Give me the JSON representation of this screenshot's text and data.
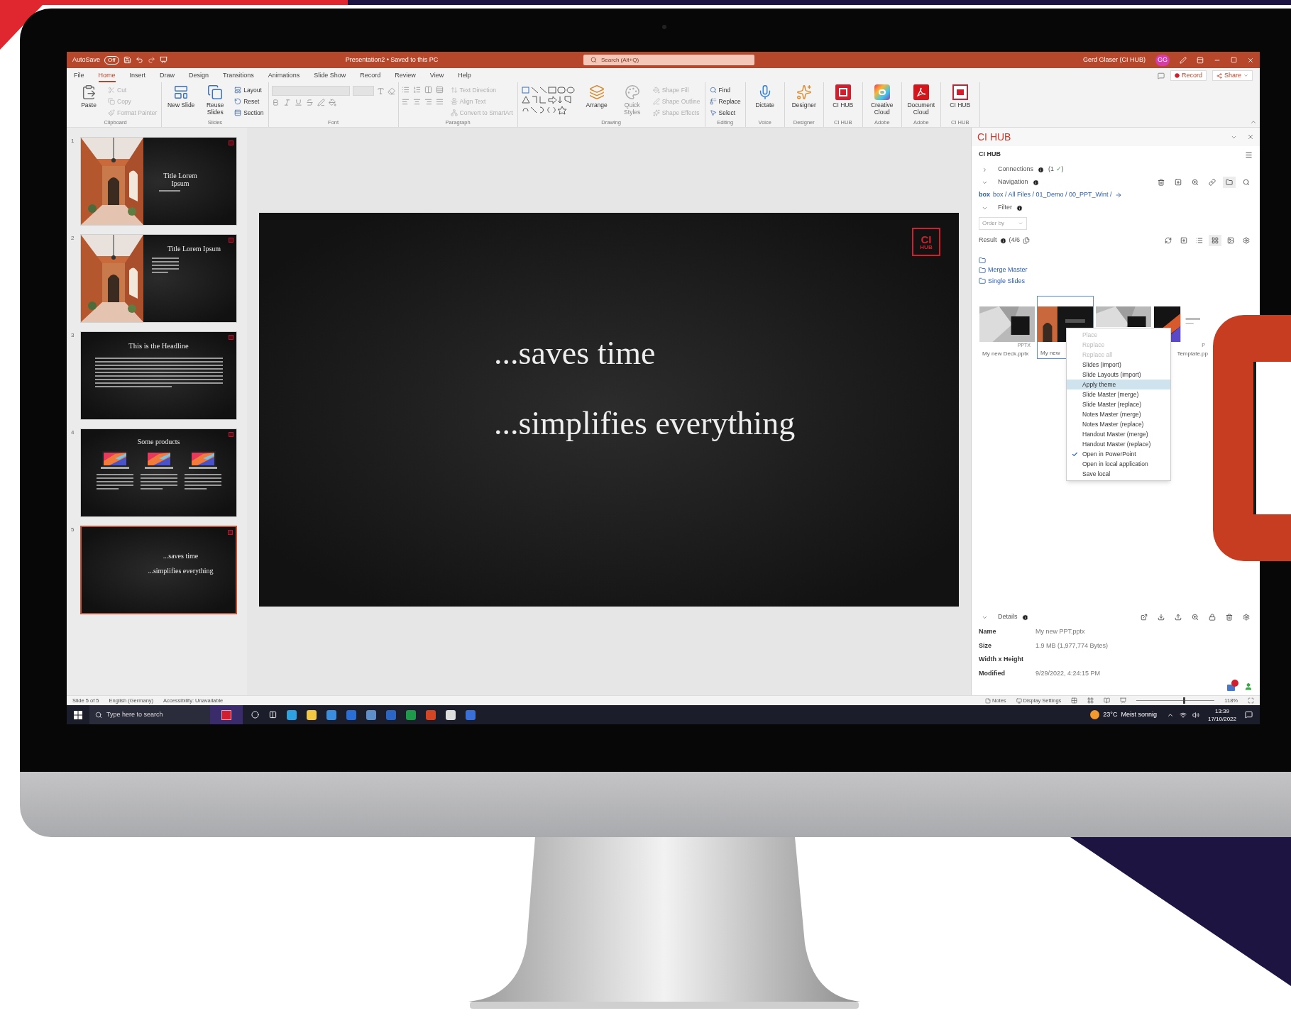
{
  "title_bar": {
    "autosave_label": "AutoSave",
    "autosave_state": "Off",
    "autosave_on": false,
    "document_title": "Presentation2 • Saved to this PC",
    "search_placeholder": "Search (Alt+Q)",
    "user_name": "Gerd Glaser (CI HUB)",
    "user_initials": "GG"
  },
  "ribbon_tabs": [
    {
      "label": "File",
      "selected": false
    },
    {
      "label": "Home",
      "selected": true
    },
    {
      "label": "Insert",
      "selected": false
    },
    {
      "label": "Draw",
      "selected": false
    },
    {
      "label": "Design",
      "selected": false
    },
    {
      "label": "Transitions",
      "selected": false
    },
    {
      "label": "Animations",
      "selected": false
    },
    {
      "label": "Slide Show",
      "selected": false
    },
    {
      "label": "Record",
      "selected": false
    },
    {
      "label": "Review",
      "selected": false
    },
    {
      "label": "View",
      "selected": false
    },
    {
      "label": "Help",
      "selected": false
    }
  ],
  "ribbon_actions": {
    "record": "Record",
    "share": "Share"
  },
  "ribbon_groups": [
    {
      "label": "Clipboard",
      "kind": "commands",
      "commands": [
        {
          "label": "Paste",
          "kind": "large",
          "disabled": false
        },
        {
          "label": "Cut",
          "kind": "small",
          "disabled": true
        },
        {
          "label": "Copy",
          "kind": "small",
          "disabled": true
        },
        {
          "label": "Format Painter",
          "kind": "small",
          "disabled": true
        }
      ]
    },
    {
      "label": "Slides",
      "kind": "commands",
      "commands": [
        {
          "label": "New Slide",
          "kind": "large",
          "disabled": false
        },
        {
          "label": "Reuse Slides",
          "kind": "large",
          "disabled": false
        },
        {
          "label": "Layout",
          "kind": "small",
          "disabled": false
        },
        {
          "label": "Reset",
          "kind": "small",
          "disabled": false
        },
        {
          "label": "Section",
          "kind": "small",
          "disabled": false
        }
      ]
    },
    {
      "label": "Font",
      "kind": "font"
    },
    {
      "label": "Paragraph",
      "kind": "paragraph",
      "commands": [
        {
          "label": "Text Direction",
          "kind": "small",
          "disabled": true
        },
        {
          "label": "Align Text",
          "kind": "small",
          "disabled": true
        },
        {
          "label": "Convert to SmartArt",
          "kind": "small",
          "disabled": true
        }
      ]
    },
    {
      "label": "Drawing",
      "kind": "drawing",
      "commands": [
        {
          "label": "Arrange",
          "kind": "large",
          "disabled": false
        },
        {
          "label": "Quick Styles",
          "kind": "large",
          "disabled": true
        },
        {
          "label": "Shape Fill",
          "kind": "small",
          "disabled": true
        },
        {
          "label": "Shape Outline",
          "kind": "small",
          "disabled": true
        },
        {
          "label": "Shape Effects",
          "kind": "small",
          "disabled": true
        }
      ]
    },
    {
      "label": "Editing",
      "kind": "commands",
      "commands": [
        {
          "label": "Find",
          "kind": "small",
          "disabled": false
        },
        {
          "label": "Replace",
          "kind": "small",
          "disabled": false
        },
        {
          "label": "Select",
          "kind": "small",
          "disabled": false
        }
      ]
    },
    {
      "label": "Voice",
      "kind": "commands",
      "commands": [
        {
          "label": "Dictate",
          "kind": "large",
          "disabled": false
        }
      ]
    },
    {
      "label": "Designer",
      "kind": "commands",
      "commands": [
        {
          "label": "Designer",
          "kind": "large",
          "disabled": false
        }
      ]
    },
    {
      "label": "CI HUB",
      "kind": "commands",
      "commands": [
        {
          "label": "CI HUB",
          "kind": "large",
          "disabled": false
        }
      ]
    },
    {
      "label": "Adobe",
      "kind": "commands",
      "commands": [
        {
          "label": "Creative Cloud",
          "kind": "large",
          "disabled": false
        }
      ]
    },
    {
      "label": "Adobe",
      "kind": "commands",
      "commands": [
        {
          "label": "Document Cloud",
          "kind": "large",
          "disabled": false
        }
      ]
    },
    {
      "label": "CI HUB",
      "kind": "commands",
      "commands": [
        {
          "label": "CI HUB",
          "kind": "large",
          "disabled": false
        }
      ]
    }
  ],
  "slides": [
    {
      "number": "1",
      "kind": "photo_title",
      "title": "Title Lorem Ipsum",
      "selected": false
    },
    {
      "number": "2",
      "kind": "photo_list",
      "title": "Title Lorem Ipsum",
      "selected": false
    },
    {
      "number": "3",
      "kind": "headline",
      "title": "This is the Headline",
      "selected": false
    },
    {
      "number": "4",
      "kind": "products",
      "title": "Some products",
      "selected": false
    },
    {
      "number": "5",
      "kind": "statement",
      "lines": [
        "...saves time",
        "...simplifies everything"
      ],
      "selected": true
    }
  ],
  "current_slide": {
    "lines": [
      "...saves time",
      "...simplifies everything"
    ],
    "logo": {
      "top": "CI",
      "bottom": "HUB"
    }
  },
  "ci_hub_pane": {
    "title": "CI HUB",
    "header": "CI HUB",
    "connections": {
      "label": "Connections",
      "count": "(1",
      "check": "✓",
      "close": ")",
      "expanded": false
    },
    "navigation": {
      "label": "Navigation",
      "expanded": true
    },
    "breadcrumb": {
      "source": "box",
      "path": "box / All Files / 01_Demo / 00_PPT_Wint /"
    },
    "filter": {
      "label": "Filter",
      "expanded": true,
      "order_placeholder": "Order by"
    },
    "result": {
      "label": "Result",
      "count": "(4/6"
    },
    "folders": [
      {
        "name": "Merge Master"
      },
      {
        "name": "Single Slides"
      }
    ],
    "files": [
      {
        "caption": "My new Deck.pptx",
        "badge": "PPTX",
        "selected": false
      },
      {
        "caption": "My new",
        "selected": true
      },
      {
        "selected": false
      },
      {
        "caption": "Template.pp",
        "badge": "P",
        "selected": false
      }
    ],
    "menu": [
      {
        "label": "Place",
        "disabled": true,
        "selected": false,
        "checked": false
      },
      {
        "label": "Replace",
        "disabled": true,
        "selected": false,
        "checked": false
      },
      {
        "label": "Replace all",
        "disabled": true,
        "selected": false,
        "checked": false
      },
      {
        "label": "Slides (import)",
        "disabled": false,
        "selected": false,
        "checked": false
      },
      {
        "label": "Slide Layouts (import)",
        "disabled": false,
        "selected": false,
        "checked": false
      },
      {
        "label": "Apply theme",
        "disabled": false,
        "selected": true,
        "checked": false
      },
      {
        "label": "Slide Master (merge)",
        "disabled": false,
        "selected": false,
        "checked": false
      },
      {
        "label": "Slide Master (replace)",
        "disabled": false,
        "selected": false,
        "checked": false
      },
      {
        "label": "Notes Master (merge)",
        "disabled": false,
        "selected": false,
        "checked": false
      },
      {
        "label": "Notes Master (replace)",
        "disabled": false,
        "selected": false,
        "checked": false
      },
      {
        "label": "Handout Master (merge)",
        "disabled": false,
        "selected": false,
        "checked": false
      },
      {
        "label": "Handout Master (replace)",
        "disabled": false,
        "selected": false,
        "checked": false
      },
      {
        "label": "Open in PowerPoint",
        "disabled": false,
        "selected": false,
        "checked": true
      },
      {
        "label": "Open in local application",
        "disabled": false,
        "selected": false,
        "checked": false
      },
      {
        "label": "Save local",
        "disabled": false,
        "selected": false,
        "checked": false
      }
    ],
    "details": {
      "label": "Details",
      "expanded": true,
      "fields": [
        {
          "label": "Name",
          "value": "My new PPT.pptx"
        },
        {
          "label": "Size",
          "value": "1.9 MB (1,977,774 Bytes)"
        },
        {
          "label": "Width x Height"
        },
        {
          "label": "Modified",
          "value": "9/29/2022, 4:24:15 PM"
        }
      ]
    }
  },
  "status_bar": {
    "items": [
      "Slide 5 of 5",
      "English (Germany)",
      "Accessibility: Unavailable"
    ],
    "notes": "Notes",
    "display_settings": "Display Settings",
    "zoom": "118%",
    "zoom_slider": {
      "level": 0.6
    }
  },
  "taskbar": {
    "search_placeholder": "Type here to search",
    "weather": "23°C  Meist sonnig",
    "time": "13:39",
    "date": "17/10/2022"
  }
}
